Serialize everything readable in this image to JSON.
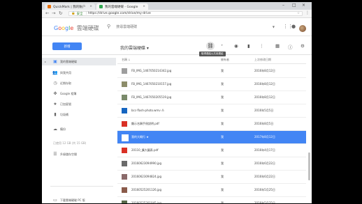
{
  "browser": {
    "tabs": [
      {
        "label": "QuickMark | 我的账户",
        "icon": "quickmark-favicon",
        "color": "#e8710a"
      },
      {
        "label": "我的雲端硬碟 - Google ",
        "icon": "drive-favicon",
        "color": "#34a853"
      }
    ],
    "security_label": "安全",
    "url": "https://drive.google.com/drive/my-drive"
  },
  "header": {
    "logo_google": [
      "G",
      "o",
      "o",
      "g",
      "l",
      "e"
    ],
    "product": "雲端硬碟",
    "search_placeholder": "搜尋雲端硬碟"
  },
  "toolbar": {
    "new_label": "新增",
    "breadcrumb": "我的雲端硬碟",
    "tooltip": "取得連結以共用連結"
  },
  "sidebar": {
    "items": [
      {
        "label": "我的雲端硬碟",
        "icon": "drive-icon",
        "selected": true
      },
      {
        "label": "與我共用",
        "icon": "people-icon"
      },
      {
        "label": "近期存取",
        "icon": "clock-icon"
      },
      {
        "label": "Google 相簿",
        "icon": "pinwheel-icon"
      },
      {
        "label": "已加星號",
        "icon": "star-icon"
      },
      {
        "label": "垃圾桶",
        "icon": "trash-icon"
      },
      {
        "label": "備份",
        "icon": "cloud-icon"
      },
      {
        "label": "升級儲存空間",
        "icon": "menu-icon"
      },
      {
        "label": "下載雲端硬碟 PC 版",
        "icon": "monitor-icon"
      }
    ],
    "storage": "已使用 12 GB (共 15 GB)"
  },
  "table": {
    "headers": {
      "name": "名稱 ↓",
      "owner": "擁有者",
      "modified": "上次修改日期"
    },
    "rows": [
      {
        "name": "FB_IMG_1467050214342.jpg",
        "owner": "我",
        "date": "2016年8月12日",
        "icon": "image-file-icon",
        "color": "#9e9e9e"
      },
      {
        "name": "FB_IMG_1467050210157.jpg",
        "owner": "我",
        "date": "2016年8月12日",
        "icon": "image-file-icon",
        "color": "#8d8d6a"
      },
      {
        "name": "FB_IMG_1467050205519.jpg",
        "owner": "我",
        "date": "2016年8月12日",
        "icon": "image-file-icon",
        "color": "#7a8a6a"
      },
      {
        "name": "bcc-flash-photo.wmv  ⁂",
        "owner": "我",
        "date": "2016年5月5日",
        "icon": "video-file-icon",
        "color": "#1565c0"
      },
      {
        "name": "顯示名稱手冊說明.pdf",
        "owner": "我",
        "date": "2016年8月5日",
        "icon": "pdf-file-icon",
        "color": "#d93025"
      },
      {
        "name": "我的大概行 ★",
        "owner": "我",
        "date": "2017年8月12日",
        "icon": "doc-file-icon",
        "color": "#ffffff",
        "selected": true
      },
      {
        "name": "20110_擴大圖表.pdf",
        "owner": "我",
        "date": "2016年4月17日",
        "icon": "pdf-file-icon",
        "color": "#d93025"
      },
      {
        "name": "20160623094990.jpg",
        "owner": "我",
        "date": "2016年6月22日",
        "icon": "image-file-icon",
        "color": "#6a6a6a"
      },
      {
        "name": "20160623094824.jpg",
        "owner": "我",
        "date": "2016年6月22日",
        "icon": "image-file-icon",
        "color": "#8a6a6a"
      },
      {
        "name": "20160525201126.jpg",
        "owner": "我",
        "date": "2016年5月25日",
        "icon": "image-file-icon",
        "color": "#8a5a4a"
      },
      {
        "name": "20160525201045.jpg",
        "owner": "我",
        "date": "2016年5月25日",
        "icon": "image-file-icon",
        "color": "#5a6a4a"
      }
    ]
  }
}
